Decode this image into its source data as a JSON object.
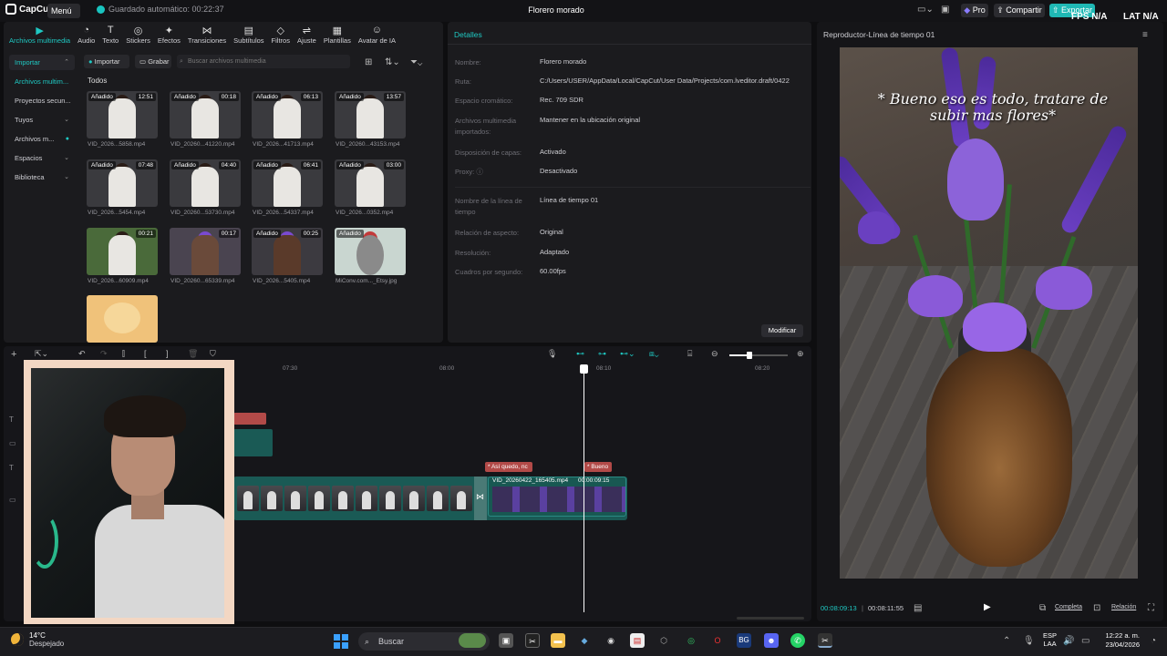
{
  "topbar": {
    "app_name": "CapCut",
    "menu_label": "Menú",
    "autosave": "Guardado automático: 00:22:37",
    "project_title": "Florero morado",
    "pro_label": "Pro",
    "share_label": "Compartir",
    "export_label": "Exportar",
    "fps_label": "FPS",
    "fps_value": "N/A",
    "lat_label": "LAT",
    "lat_value": "N/A"
  },
  "tooltabs": [
    {
      "label": "Archivos multimedia",
      "icon": "media-icon"
    },
    {
      "label": "Audio",
      "icon": "audio-icon"
    },
    {
      "label": "Texto",
      "icon": "text-icon"
    },
    {
      "label": "Stickers",
      "icon": "sticker-icon"
    },
    {
      "label": "Efectos",
      "icon": "effects-icon"
    },
    {
      "label": "Transiciones",
      "icon": "transition-icon"
    },
    {
      "label": "Subtítulos",
      "icon": "subtitle-icon"
    },
    {
      "label": "Filtros",
      "icon": "filter-icon"
    },
    {
      "label": "Ajuste",
      "icon": "adjust-icon"
    },
    {
      "label": "Plantillas",
      "icon": "template-icon"
    },
    {
      "label": "Avatar de IA",
      "icon": "ai-avatar-icon"
    }
  ],
  "sidenav": [
    {
      "label": "Importar"
    },
    {
      "label": "Archivos multim..."
    },
    {
      "label": "Proyectos secun..."
    },
    {
      "label": "Tuyos"
    },
    {
      "label": "Archivos m..."
    },
    {
      "label": "Espacios"
    },
    {
      "label": "Biblioteca"
    }
  ],
  "media": {
    "import_label": "Importar",
    "record_label": "Grabar",
    "search_placeholder": "Buscar archivos multimedia",
    "all_label": "Todos",
    "clips": [
      {
        "badge": "Añadido",
        "duration": "12:51",
        "name": "VID_2026...5858.mp4"
      },
      {
        "badge": "Añadido",
        "duration": "00:18",
        "name": "VID_20260...41220.mp4"
      },
      {
        "badge": "Añadido",
        "duration": "06:13",
        "name": "VID_2026...41713.mp4"
      },
      {
        "badge": "Añadido",
        "duration": "13:57",
        "name": "VID_20260...43153.mp4"
      },
      {
        "badge": "Añadido",
        "duration": "07:48",
        "name": "VID_2026...5454.mp4"
      },
      {
        "badge": "Añadido",
        "duration": "04:40",
        "name": "VID_20260...53730.mp4"
      },
      {
        "badge": "Añadido",
        "duration": "06:41",
        "name": "VID_2026...54337.mp4"
      },
      {
        "badge": "Añadido",
        "duration": "03:00",
        "name": "VID_2026...0352.mp4"
      },
      {
        "badge": "",
        "duration": "00:21",
        "name": "VID_2026...60909.mp4"
      },
      {
        "badge": "",
        "duration": "00:17",
        "name": "VID_20260...65339.mp4"
      },
      {
        "badge": "Añadido",
        "duration": "00:25",
        "name": "VID_2026...5405.mp4"
      },
      {
        "badge": "Añadido",
        "duration": "",
        "name": "MiConv.com..._Etsy.jpg"
      },
      {
        "badge": "",
        "duration": "",
        "name": ""
      }
    ]
  },
  "details": {
    "title": "Detalles",
    "rows": [
      {
        "key": "Nombre:",
        "value": "Florero morado"
      },
      {
        "key": "Ruta:",
        "value": "C:/Users/USER/AppData/Local/CapCut/User Data/Projects/com.lveditor.draft/0422"
      },
      {
        "key": "Espacio cromático:",
        "value": "Rec. 709 SDR"
      },
      {
        "key": "Archivos multimedia importados:",
        "value": "Mantener en la ubicación original"
      },
      {
        "key": "Disposición de capas:",
        "value": "Activado"
      },
      {
        "key": "Proxy:",
        "value": "Desactivado"
      },
      {
        "key": "Nombre de la línea de tiempo",
        "value": "Línea de tiempo 01"
      },
      {
        "key": "Relación de aspecto:",
        "value": "Original"
      },
      {
        "key": "Resolución:",
        "value": "Adaptado"
      },
      {
        "key": "Cuadros por segundo:",
        "value": "60.00fps"
      }
    ],
    "modify_label": "Modificar"
  },
  "player": {
    "title": "Reproductor-Línea de tiempo 01",
    "caption": "* Bueno eso es todo, tratare de subir mas flores*",
    "time_current": "00:08:09:13",
    "time_total": "00:08:11:55",
    "full_label": "Completa",
    "ratio_label": "Relación"
  },
  "timeline": {
    "ticks": [
      "07:30",
      "08:00",
      "08:10",
      "08:20"
    ],
    "text_clip_1": "* Así quedo, nc",
    "text_clip_2": "* Bueno",
    "clip2_name": "VID_20260422_165405.mp4",
    "clip2_duration": "00:00:09:15"
  },
  "taskbar": {
    "temp": "14°C",
    "condition": "Despejado",
    "search_label": "Buscar",
    "lang_1": "ESP",
    "lang_2": "LAA",
    "time": "12:22 a. m.",
    "date": "23/04/2026"
  }
}
